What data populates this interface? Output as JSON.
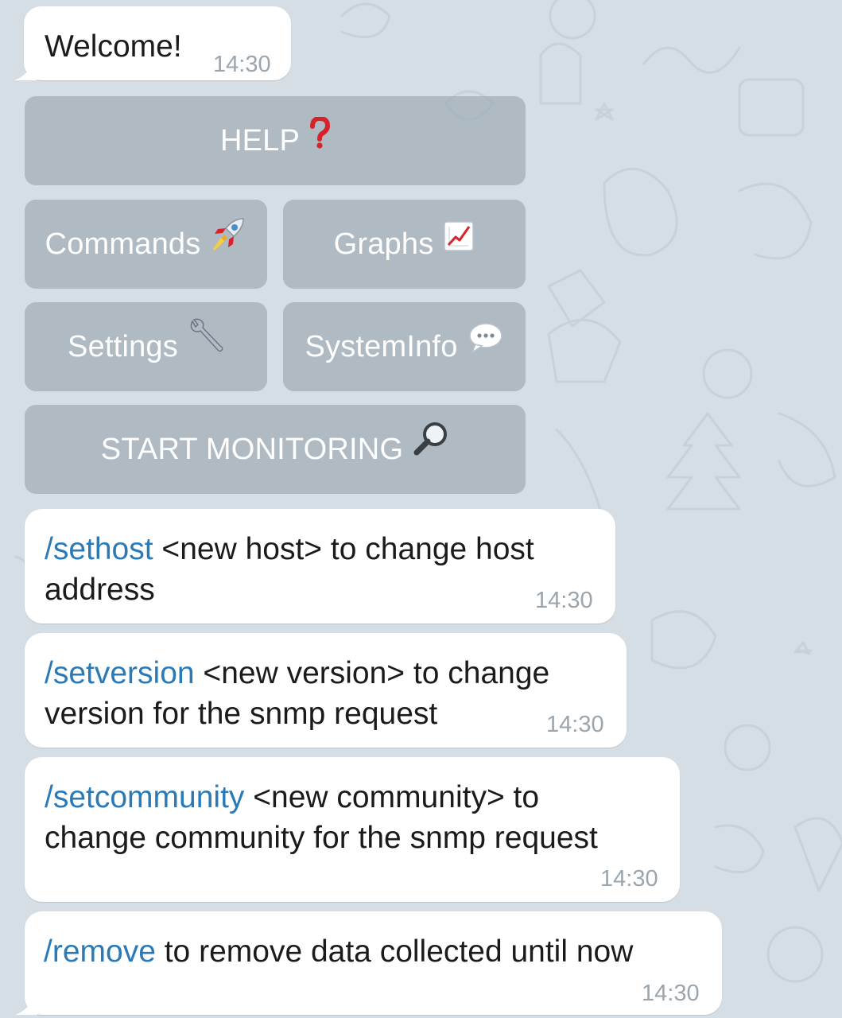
{
  "welcome": {
    "text": "Welcome!",
    "time": "14:30"
  },
  "keyboard": {
    "help": {
      "label": "HELP",
      "icon": "red-question-mark-icon"
    },
    "commands": {
      "label": "Commands",
      "icon": "rocket-icon"
    },
    "graphs": {
      "label": "Graphs",
      "icon": "chart-increasing-icon"
    },
    "settings": {
      "label": "Settings",
      "icon": "wrench-icon"
    },
    "systeminfo": {
      "label": "SystemInfo",
      "icon": "speech-bubble-icon"
    },
    "start_monitoring": {
      "label": "START MONITORING",
      "icon": "magnifying-glass-icon"
    }
  },
  "messages": [
    {
      "command": "/sethost",
      "line1": " <new host> to change host",
      "line2": "address",
      "time": "14:30"
    },
    {
      "command": "/setversion",
      "line1": " <new version> to change",
      "line2": "version for the snmp request",
      "time": "14:30"
    },
    {
      "command": "/setcommunity",
      "line1": " <new community> to",
      "line2": "change community for the snmp request",
      "time": "14:30"
    },
    {
      "command": "/remove",
      "line1": " to remove data collected until now",
      "time": "14:30"
    }
  ],
  "colors": {
    "background": "#d6dee5",
    "command_link": "#2a7ab8",
    "keyboard_button": "#a0acb5",
    "timestamp": "#9aa5ad"
  }
}
